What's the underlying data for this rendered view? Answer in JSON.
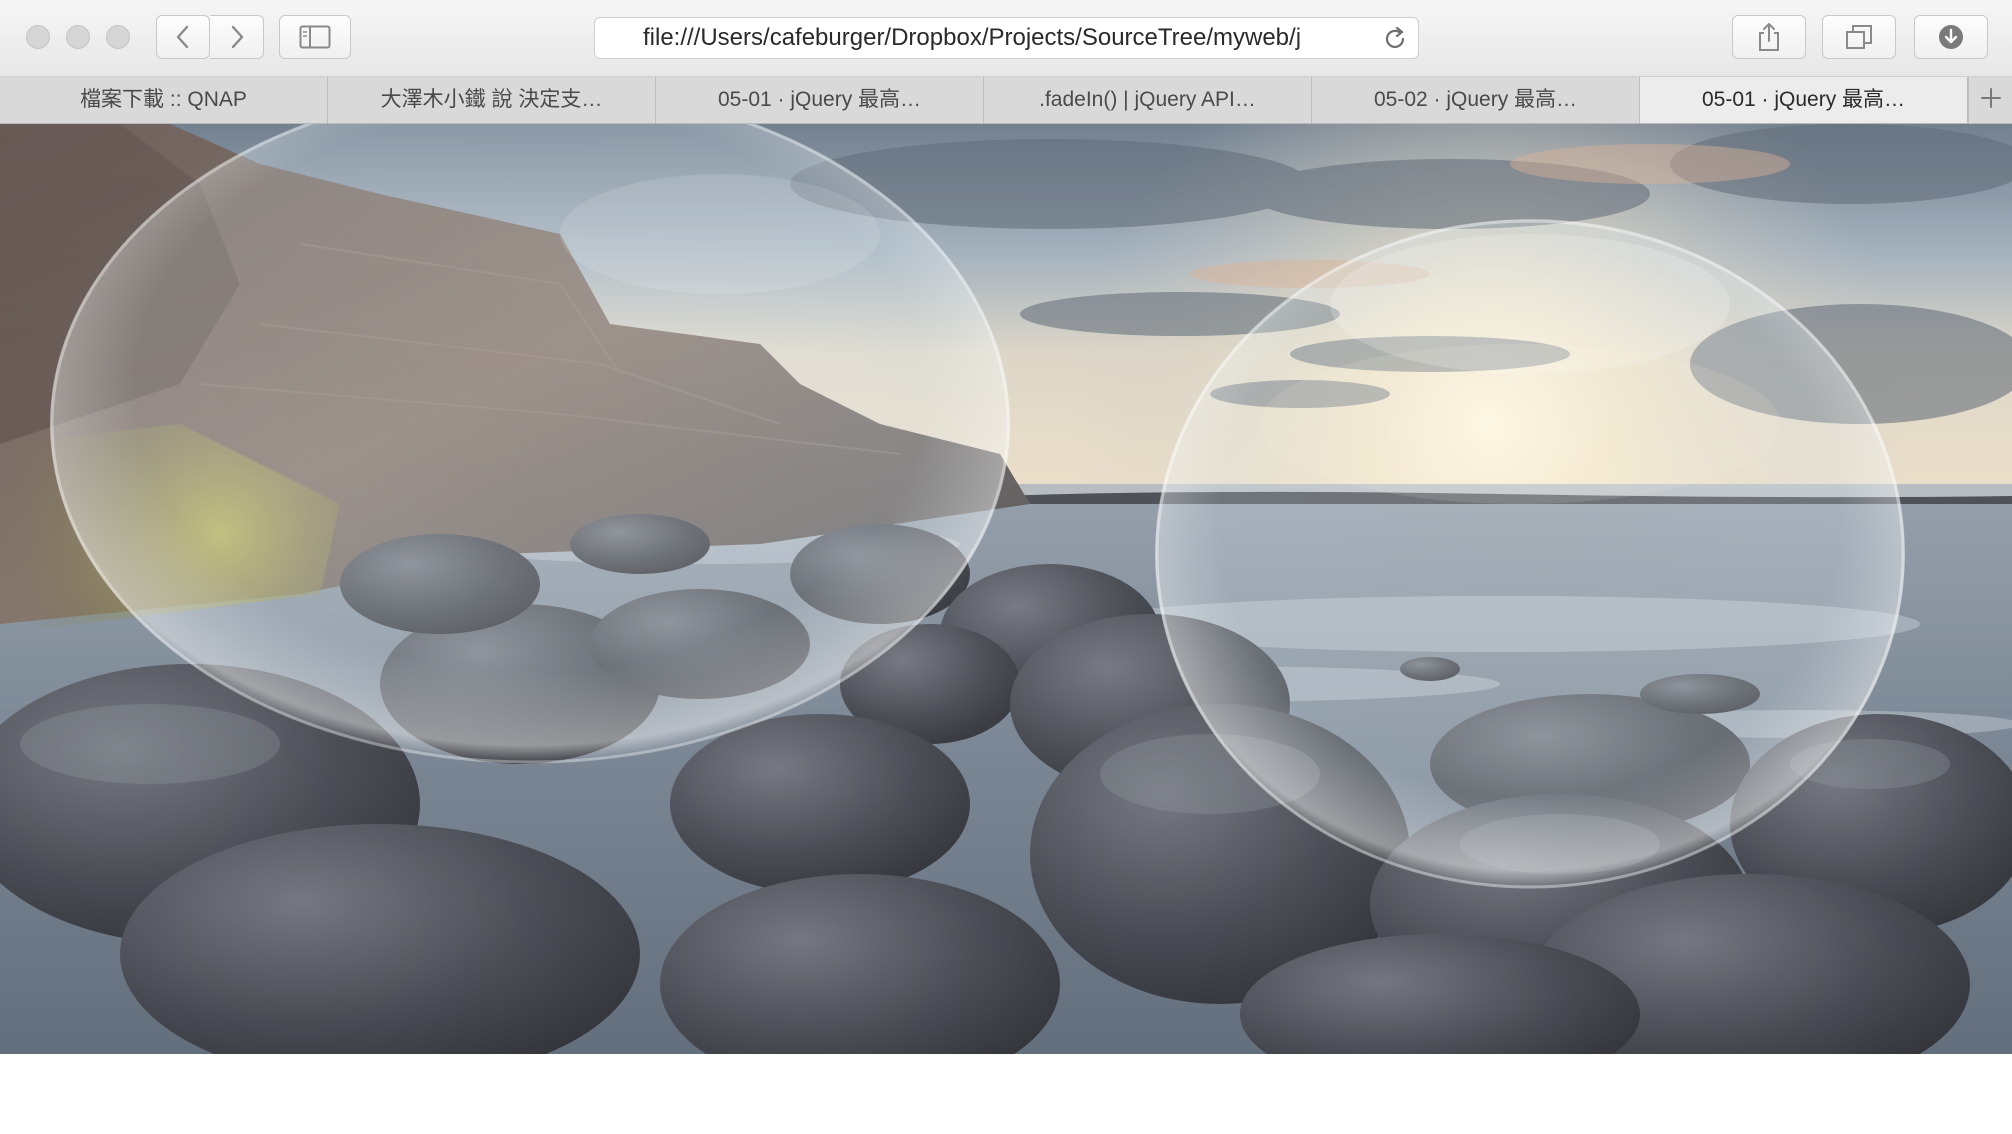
{
  "window": {
    "traffic_lights": [
      "close",
      "minimize",
      "zoom"
    ]
  },
  "toolbar": {
    "back_icon": "chevron-left-icon",
    "forward_icon": "chevron-right-icon",
    "sidebar_icon": "sidebar-icon",
    "share_icon": "share-icon",
    "tabs_overview_icon": "tabs-overview-icon",
    "downloads_icon": "download-icon"
  },
  "address_bar": {
    "url": "file:///Users/cafeburger/Dropbox/Projects/SourceTree/myweb/j",
    "reload_icon": "reload-icon"
  },
  "tabs": [
    {
      "label": "檔案下載 :: QNAP"
    },
    {
      "label": "大澤木小鐵 說 決定支…"
    },
    {
      "label": "05-01 · jQuery 最高…"
    },
    {
      "label": ".fadeIn() | jQuery API…"
    },
    {
      "label": "05-02 · jQuery 最高…"
    },
    {
      "label": "05-01 · jQuery 最高…"
    }
  ],
  "active_tab_index": 5,
  "new_tab_icon": "plus-icon",
  "content": {
    "image_subject": "rocky-seashore-sunset",
    "bubble_count": 2
  },
  "colors": {
    "toolbar_bg": "#ececec",
    "tabbar_bg": "#d9d9d9",
    "active_tab_bg": "#ececec"
  }
}
